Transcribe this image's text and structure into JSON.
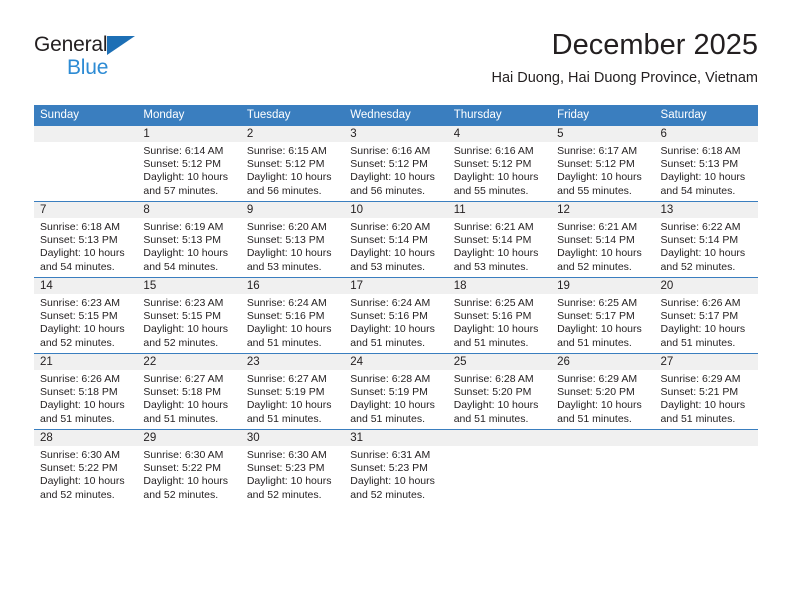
{
  "brand": {
    "line1": "General",
    "line2": "Blue",
    "triangle_color": "#1d6fb5",
    "blue_text_color": "#2d8bd4"
  },
  "header": {
    "title": "December 2025",
    "subtitle": "Hai Duong, Hai Duong Province, Vietnam"
  },
  "theme": {
    "header_row_bg": "#3a7ebf",
    "header_row_text": "#ffffff",
    "daynum_band_bg": "#f0f0f0",
    "row_divider": "#3a7ebf",
    "body_text": "#231f20"
  },
  "weekday_headers": [
    "Sunday",
    "Monday",
    "Tuesday",
    "Wednesday",
    "Thursday",
    "Friday",
    "Saturday"
  ],
  "weeks": [
    [
      {
        "blank": true,
        "day": "",
        "sunrise": "",
        "sunset": "",
        "daylight1": "",
        "daylight2": ""
      },
      {
        "blank": false,
        "day": "1",
        "sunrise": "Sunrise: 6:14 AM",
        "sunset": "Sunset: 5:12 PM",
        "daylight1": "Daylight: 10 hours",
        "daylight2": "and 57 minutes."
      },
      {
        "blank": false,
        "day": "2",
        "sunrise": "Sunrise: 6:15 AM",
        "sunset": "Sunset: 5:12 PM",
        "daylight1": "Daylight: 10 hours",
        "daylight2": "and 56 minutes."
      },
      {
        "blank": false,
        "day": "3",
        "sunrise": "Sunrise: 6:16 AM",
        "sunset": "Sunset: 5:12 PM",
        "daylight1": "Daylight: 10 hours",
        "daylight2": "and 56 minutes."
      },
      {
        "blank": false,
        "day": "4",
        "sunrise": "Sunrise: 6:16 AM",
        "sunset": "Sunset: 5:12 PM",
        "daylight1": "Daylight: 10 hours",
        "daylight2": "and 55 minutes."
      },
      {
        "blank": false,
        "day": "5",
        "sunrise": "Sunrise: 6:17 AM",
        "sunset": "Sunset: 5:12 PM",
        "daylight1": "Daylight: 10 hours",
        "daylight2": "and 55 minutes."
      },
      {
        "blank": false,
        "day": "6",
        "sunrise": "Sunrise: 6:18 AM",
        "sunset": "Sunset: 5:13 PM",
        "daylight1": "Daylight: 10 hours",
        "daylight2": "and 54 minutes."
      }
    ],
    [
      {
        "blank": false,
        "day": "7",
        "sunrise": "Sunrise: 6:18 AM",
        "sunset": "Sunset: 5:13 PM",
        "daylight1": "Daylight: 10 hours",
        "daylight2": "and 54 minutes."
      },
      {
        "blank": false,
        "day": "8",
        "sunrise": "Sunrise: 6:19 AM",
        "sunset": "Sunset: 5:13 PM",
        "daylight1": "Daylight: 10 hours",
        "daylight2": "and 54 minutes."
      },
      {
        "blank": false,
        "day": "9",
        "sunrise": "Sunrise: 6:20 AM",
        "sunset": "Sunset: 5:13 PM",
        "daylight1": "Daylight: 10 hours",
        "daylight2": "and 53 minutes."
      },
      {
        "blank": false,
        "day": "10",
        "sunrise": "Sunrise: 6:20 AM",
        "sunset": "Sunset: 5:14 PM",
        "daylight1": "Daylight: 10 hours",
        "daylight2": "and 53 minutes."
      },
      {
        "blank": false,
        "day": "11",
        "sunrise": "Sunrise: 6:21 AM",
        "sunset": "Sunset: 5:14 PM",
        "daylight1": "Daylight: 10 hours",
        "daylight2": "and 53 minutes."
      },
      {
        "blank": false,
        "day": "12",
        "sunrise": "Sunrise: 6:21 AM",
        "sunset": "Sunset: 5:14 PM",
        "daylight1": "Daylight: 10 hours",
        "daylight2": "and 52 minutes."
      },
      {
        "blank": false,
        "day": "13",
        "sunrise": "Sunrise: 6:22 AM",
        "sunset": "Sunset: 5:14 PM",
        "daylight1": "Daylight: 10 hours",
        "daylight2": "and 52 minutes."
      }
    ],
    [
      {
        "blank": false,
        "day": "14",
        "sunrise": "Sunrise: 6:23 AM",
        "sunset": "Sunset: 5:15 PM",
        "daylight1": "Daylight: 10 hours",
        "daylight2": "and 52 minutes."
      },
      {
        "blank": false,
        "day": "15",
        "sunrise": "Sunrise: 6:23 AM",
        "sunset": "Sunset: 5:15 PM",
        "daylight1": "Daylight: 10 hours",
        "daylight2": "and 52 minutes."
      },
      {
        "blank": false,
        "day": "16",
        "sunrise": "Sunrise: 6:24 AM",
        "sunset": "Sunset: 5:16 PM",
        "daylight1": "Daylight: 10 hours",
        "daylight2": "and 51 minutes."
      },
      {
        "blank": false,
        "day": "17",
        "sunrise": "Sunrise: 6:24 AM",
        "sunset": "Sunset: 5:16 PM",
        "daylight1": "Daylight: 10 hours",
        "daylight2": "and 51 minutes."
      },
      {
        "blank": false,
        "day": "18",
        "sunrise": "Sunrise: 6:25 AM",
        "sunset": "Sunset: 5:16 PM",
        "daylight1": "Daylight: 10 hours",
        "daylight2": "and 51 minutes."
      },
      {
        "blank": false,
        "day": "19",
        "sunrise": "Sunrise: 6:25 AM",
        "sunset": "Sunset: 5:17 PM",
        "daylight1": "Daylight: 10 hours",
        "daylight2": "and 51 minutes."
      },
      {
        "blank": false,
        "day": "20",
        "sunrise": "Sunrise: 6:26 AM",
        "sunset": "Sunset: 5:17 PM",
        "daylight1": "Daylight: 10 hours",
        "daylight2": "and 51 minutes."
      }
    ],
    [
      {
        "blank": false,
        "day": "21",
        "sunrise": "Sunrise: 6:26 AM",
        "sunset": "Sunset: 5:18 PM",
        "daylight1": "Daylight: 10 hours",
        "daylight2": "and 51 minutes."
      },
      {
        "blank": false,
        "day": "22",
        "sunrise": "Sunrise: 6:27 AM",
        "sunset": "Sunset: 5:18 PM",
        "daylight1": "Daylight: 10 hours",
        "daylight2": "and 51 minutes."
      },
      {
        "blank": false,
        "day": "23",
        "sunrise": "Sunrise: 6:27 AM",
        "sunset": "Sunset: 5:19 PM",
        "daylight1": "Daylight: 10 hours",
        "daylight2": "and 51 minutes."
      },
      {
        "blank": false,
        "day": "24",
        "sunrise": "Sunrise: 6:28 AM",
        "sunset": "Sunset: 5:19 PM",
        "daylight1": "Daylight: 10 hours",
        "daylight2": "and 51 minutes."
      },
      {
        "blank": false,
        "day": "25",
        "sunrise": "Sunrise: 6:28 AM",
        "sunset": "Sunset: 5:20 PM",
        "daylight1": "Daylight: 10 hours",
        "daylight2": "and 51 minutes."
      },
      {
        "blank": false,
        "day": "26",
        "sunrise": "Sunrise: 6:29 AM",
        "sunset": "Sunset: 5:20 PM",
        "daylight1": "Daylight: 10 hours",
        "daylight2": "and 51 minutes."
      },
      {
        "blank": false,
        "day": "27",
        "sunrise": "Sunrise: 6:29 AM",
        "sunset": "Sunset: 5:21 PM",
        "daylight1": "Daylight: 10 hours",
        "daylight2": "and 51 minutes."
      }
    ],
    [
      {
        "blank": false,
        "day": "28",
        "sunrise": "Sunrise: 6:30 AM",
        "sunset": "Sunset: 5:22 PM",
        "daylight1": "Daylight: 10 hours",
        "daylight2": "and 52 minutes."
      },
      {
        "blank": false,
        "day": "29",
        "sunrise": "Sunrise: 6:30 AM",
        "sunset": "Sunset: 5:22 PM",
        "daylight1": "Daylight: 10 hours",
        "daylight2": "and 52 minutes."
      },
      {
        "blank": false,
        "day": "30",
        "sunrise": "Sunrise: 6:30 AM",
        "sunset": "Sunset: 5:23 PM",
        "daylight1": "Daylight: 10 hours",
        "daylight2": "and 52 minutes."
      },
      {
        "blank": false,
        "day": "31",
        "sunrise": "Sunrise: 6:31 AM",
        "sunset": "Sunset: 5:23 PM",
        "daylight1": "Daylight: 10 hours",
        "daylight2": "and 52 minutes."
      },
      {
        "blank": true,
        "day": "",
        "sunrise": "",
        "sunset": "",
        "daylight1": "",
        "daylight2": ""
      },
      {
        "blank": true,
        "day": "",
        "sunrise": "",
        "sunset": "",
        "daylight1": "",
        "daylight2": ""
      },
      {
        "blank": true,
        "day": "",
        "sunrise": "",
        "sunset": "",
        "daylight1": "",
        "daylight2": ""
      }
    ]
  ]
}
